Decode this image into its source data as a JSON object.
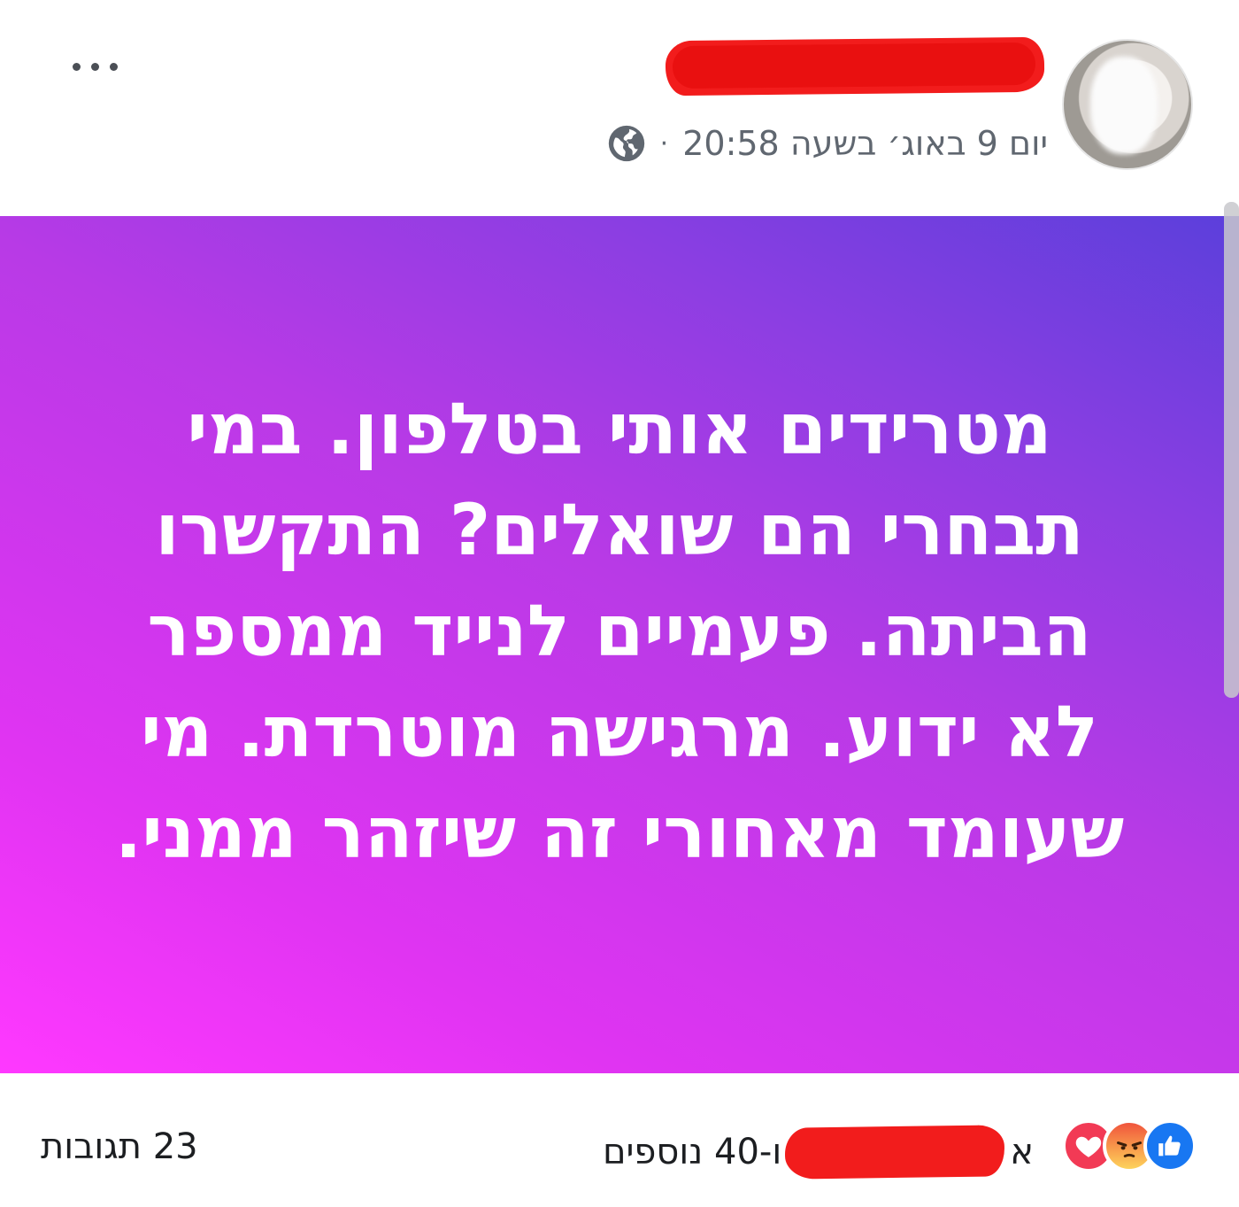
{
  "header": {
    "author_name": "",
    "timestamp": "יום 9 באוג׳ בשעה 20:58",
    "separator": "·",
    "privacy_icon": "globe-icon",
    "more_icon": "more-options-icon"
  },
  "post": {
    "text": "מטרידים אותי בטלפון. במי תבחרי הם שואלים? התקשרו הביתה. פעמיים לנייד ממספר לא ידוע. מרגישה מוטרדת. מי שעומד מאחורי זה שיזהר ממני.",
    "background_gradient": [
      "#ff38ff",
      "#b83ae6",
      "#5b3fdb"
    ],
    "text_color": "#ffffff"
  },
  "footer": {
    "reaction_icons": [
      "like-icon",
      "angry-icon",
      "love-icon"
    ],
    "reactions_leading": "א",
    "reactions_trailing": "ו-40 נוספים",
    "comments": "23 תגובות"
  },
  "colors": {
    "meta_text": "#606770",
    "like": "#1877f2",
    "love": "#f23a55",
    "redaction": "#f21c1c"
  }
}
